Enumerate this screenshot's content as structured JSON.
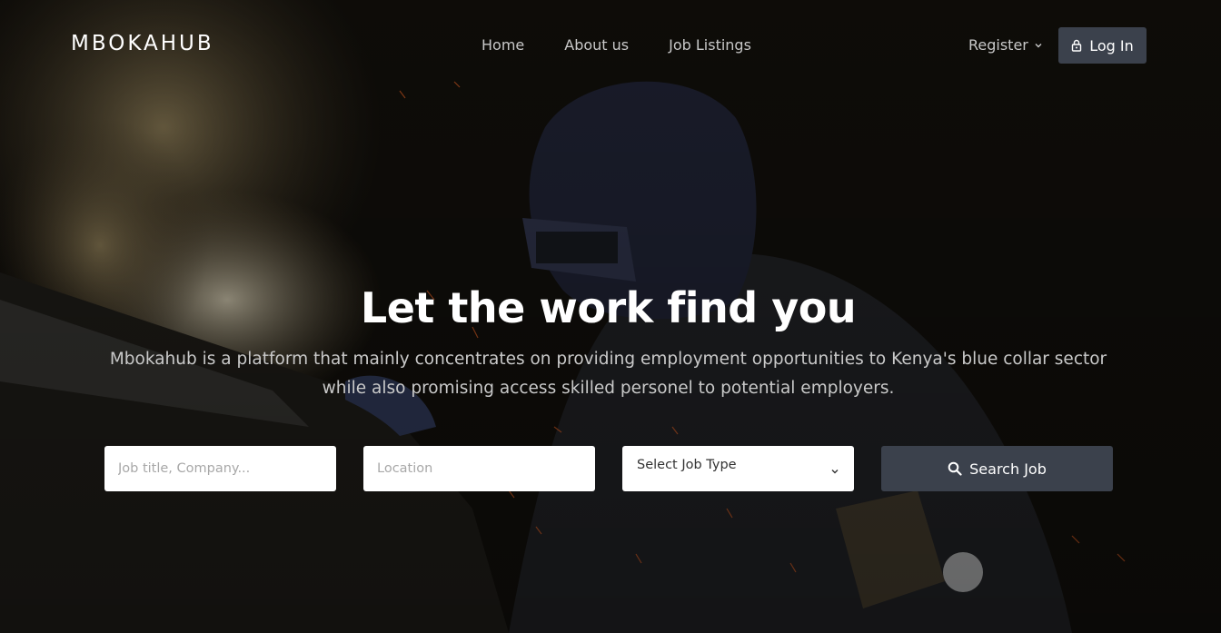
{
  "nav": {
    "brand": "MBOKAHUB",
    "links": [
      "Home",
      "About us",
      "Job Listings"
    ],
    "register_label": "Register",
    "login_label": "Log In"
  },
  "hero": {
    "headline": "Let the work find you",
    "subtext": "Mbokahub is a platform that mainly concentrates on providing employment opportunities to Kenya's blue collar sector while also promising access skilled personel to potential employers."
  },
  "search": {
    "job_placeholder": "Job title, Company...",
    "location_placeholder": "Location",
    "job_type_selected": "Select Job Type",
    "button_label": "Search Job"
  },
  "icons": {
    "login": "lock-icon",
    "register_caret": "chevron-down-icon",
    "select_caret": "chevron-down-icon",
    "search": "search-icon"
  },
  "colors": {
    "button_bg": "#3b414c",
    "text_white": "#ffffff",
    "nav_text": "#c8c8c8"
  }
}
